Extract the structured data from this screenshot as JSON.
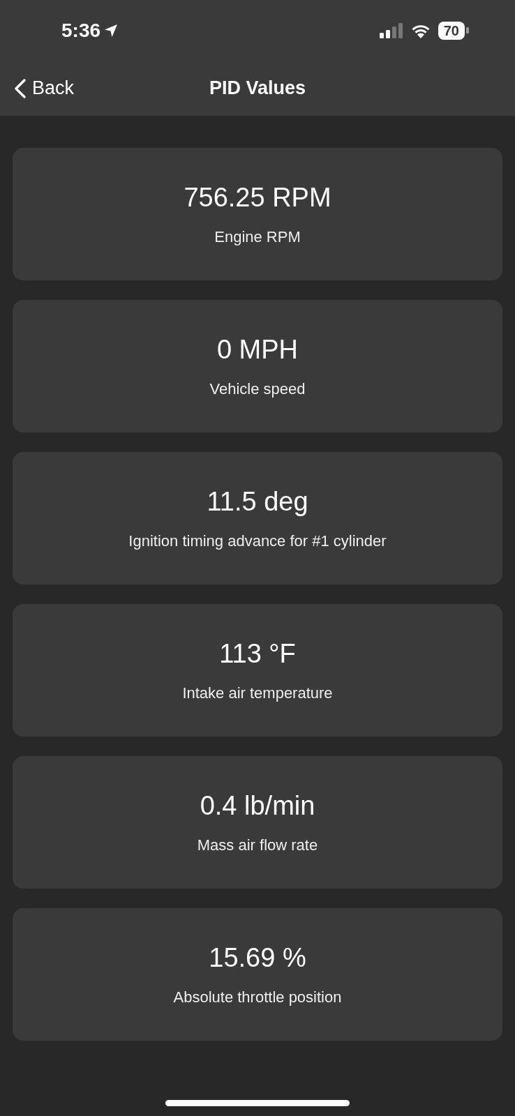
{
  "status_bar": {
    "time": "5:36",
    "battery": "70"
  },
  "nav": {
    "back": "Back",
    "title": "PID Values"
  },
  "readings": [
    {
      "value": "756.25 RPM",
      "label": "Engine RPM"
    },
    {
      "value": "0 MPH",
      "label": "Vehicle speed"
    },
    {
      "value": "11.5 deg",
      "label": "Ignition timing advance for #1 cylinder"
    },
    {
      "value": "113 °F",
      "label": "Intake air temperature"
    },
    {
      "value": "0.4 lb/min",
      "label": "Mass air flow rate"
    },
    {
      "value": "15.69 %",
      "label": "Absolute throttle position"
    }
  ]
}
